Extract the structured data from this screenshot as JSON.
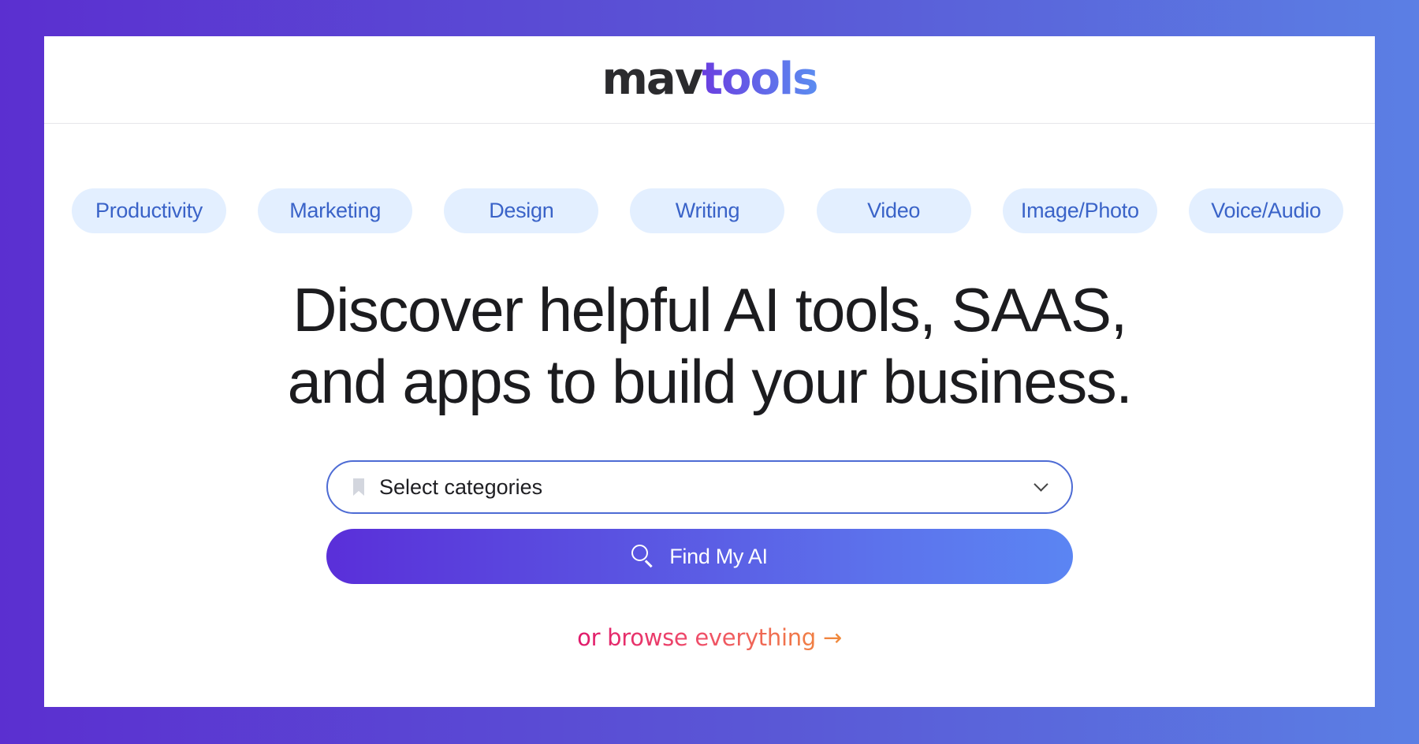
{
  "brand": {
    "logo_part1": "mav",
    "logo_part2": "tools"
  },
  "categories": [
    {
      "label": "Productivity"
    },
    {
      "label": "Marketing"
    },
    {
      "label": "Design"
    },
    {
      "label": "Writing"
    },
    {
      "label": "Video"
    },
    {
      "label": "Image/Photo"
    },
    {
      "label": "Voice/Audio"
    }
  ],
  "hero": {
    "headline_line1": "Discover helpful AI tools, SAAS,",
    "headline_line2": "and apps to build your business."
  },
  "search": {
    "select_placeholder": "Select categories",
    "button_label": "Find My AI",
    "icons": {
      "select": "bookmark-icon",
      "dropdown": "chevron-down-icon",
      "button": "search-icon"
    }
  },
  "browse": {
    "label": "or browse everything →"
  },
  "colors": {
    "bg_gradient_start": "#5b2fd0",
    "bg_gradient_end": "#5b7fe4",
    "chip_bg": "#e3efff",
    "chip_text": "#3a63c8",
    "select_border": "#4d6bd4",
    "button_gradient_start": "#5a2fd9",
    "button_gradient_end": "#5b85f3",
    "browse_gradient_start": "#e0196b",
    "browse_gradient_end": "#f08a3a"
  }
}
